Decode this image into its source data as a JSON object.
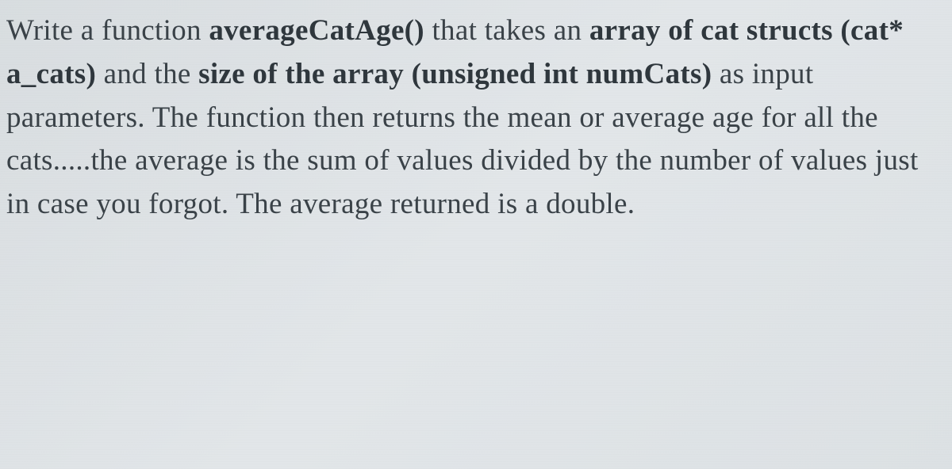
{
  "question": {
    "text_parts": {
      "p1": "Write a function ",
      "p2": "averageCatAge()",
      "p3": " that takes an ",
      "p4": "array of cat structs (cat* a_cats)",
      "p5": " and the ",
      "p6": "size of the array (unsigned int numCats)",
      "p7": " as input parameters.  The function then returns the mean or average age for all the cats.....the average is the sum of values divided by the number of values just in case you forgot.  The average returned is a double."
    }
  }
}
